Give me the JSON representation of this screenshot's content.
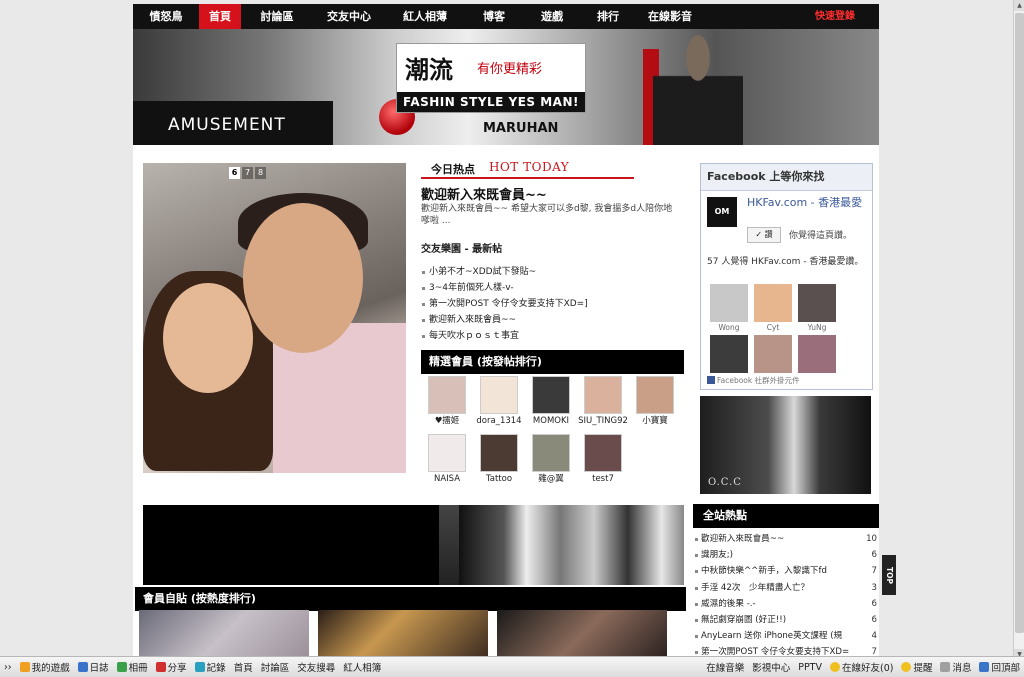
{
  "nav": {
    "items": [
      "憤怒鳥",
      "首頁",
      "討論區",
      "交友中心",
      "紅人相薄",
      "博客",
      "遊戲",
      "排行",
      "在線影音"
    ],
    "active_index": 1,
    "quick_login": "快速登錄"
  },
  "banner": {
    "logo_cn": "潮流",
    "logo_sub": "有你更精彩",
    "logo_en": "FASHIN STYLE YES MAN!",
    "sign_text": "AMUSEMENT",
    "sign_text2": "MARUHAN"
  },
  "slideshow": {
    "pages": [
      "6",
      "7",
      "8"
    ],
    "active_page": "6"
  },
  "hot_today": {
    "label_cn": "今日热点",
    "label_en": "HOT TODAY",
    "title": "歡迎新入來既會員~~",
    "desc": "歡迎新入來既會員~~ 希望大家可以多d黎, 我會搵多d人陪你地嗲啦 ..."
  },
  "club": {
    "title": "交友樂園 - 最新帖",
    "posts": [
      "小弟不才~XDD試下發貼~",
      "3~4年前個死人樣-v-",
      "第一次開POST 令仔令女要支持下XD=]",
      "歡迎新入來既會員~~",
      "每天吹水ｐｏｓｔ事宜"
    ]
  },
  "members": {
    "title": "精選會員 (按發帖排行)",
    "list": [
      {
        "name": "♥擂姬",
        "color": "#d8c0b8"
      },
      {
        "name": "dora_1314",
        "color": "#f2e4d6"
      },
      {
        "name": "MOMOKI",
        "color": "#3a3a3a"
      },
      {
        "name": "SIU_TING92",
        "color": "#d9b19c"
      },
      {
        "name": "小寶寶",
        "color": "#c99f88"
      },
      {
        "name": "NAISA",
        "color": "#f0eaea"
      },
      {
        "name": "Tattoo",
        "color": "#4b3b32"
      },
      {
        "name": "雞@翼",
        "color": "#8a8a7a"
      },
      {
        "name": "test7",
        "color": "#6b4c4c"
      }
    ]
  },
  "facebook": {
    "header": "Facebook 上等你來找",
    "page_icon": "OM",
    "page_name": "HKFav.com - 香港最愛",
    "like_label": "讚",
    "like_info": "你覺得這頁讚。",
    "count_text": "57 人覺得 HKFav.com - 香港最愛讚。",
    "fans": [
      {
        "name": "Wong",
        "color": "#c8c8c8"
      },
      {
        "name": "Cyt",
        "color": "#e7b68f"
      },
      {
        "name": "YuNg",
        "color": "#5a5050"
      },
      {
        "name": "",
        "color": "#3c3c3c"
      },
      {
        "name": "",
        "color": "#b89388"
      },
      {
        "name": "",
        "color": "#9a6e7a"
      }
    ],
    "plugin": "Facebook 社群外掛元件"
  },
  "right_photo_sig": "O.C.C",
  "site_hot": {
    "title": "全站熱點",
    "items": [
      {
        "text": "歡迎新入來既會員~~",
        "count": "10"
      },
      {
        "text": "識朋友;)",
        "count": "6"
      },
      {
        "text": "中秋節快樂^^新手，入黎識下fd",
        "count": "7"
      },
      {
        "text": "手淫 42次　少年精盡人亡？",
        "count": "3"
      },
      {
        "text": "威濕的後果 -.-",
        "count": "6"
      },
      {
        "text": "無記劇穿崩圖 (好正!!)",
        "count": "6"
      },
      {
        "text": "AnyLearn 送你 iPhone英文課程 (規",
        "count": "4"
      },
      {
        "text": "第一次開POST 令仔令女要支持下XD=",
        "count": "7"
      }
    ]
  },
  "member_posts": {
    "title": "會員自貼 (按熱度排行)"
  },
  "top_button": "TOP",
  "bottombar": {
    "left": [
      {
        "label": "我的遊戲",
        "icon": "game-icon",
        "color": "#f0a020"
      },
      {
        "label": "日誌",
        "icon": "journal-icon",
        "color": "#3a74c9"
      },
      {
        "label": "相冊",
        "icon": "album-icon",
        "color": "#3aa04a"
      },
      {
        "label": "分享",
        "icon": "share-icon",
        "color": "#d03030"
      },
      {
        "label": "記錄",
        "icon": "record-icon",
        "color": "#2aa0c0"
      },
      {
        "label": "首頁",
        "icon": "",
        "color": ""
      },
      {
        "label": "討論區",
        "icon": "",
        "color": ""
      },
      {
        "label": "交友搜尋",
        "icon": "",
        "color": ""
      },
      {
        "label": "紅人相簿",
        "icon": "",
        "color": ""
      }
    ],
    "right": [
      {
        "label": "在線音樂",
        "icon": "",
        "color": ""
      },
      {
        "label": "影視中心",
        "icon": "",
        "color": ""
      },
      {
        "label": "PPTV",
        "icon": "",
        "color": ""
      },
      {
        "label": "在線好友(0)",
        "icon": "friends-icon",
        "color": "#f0c020"
      },
      {
        "label": "提醒",
        "icon": "bell-icon",
        "color": "#f0c020"
      },
      {
        "label": "消息",
        "icon": "message-icon",
        "color": "#a0a0a0"
      },
      {
        "label": "回頂部",
        "icon": "back-top-icon",
        "color": "#3a74c9"
      }
    ]
  }
}
